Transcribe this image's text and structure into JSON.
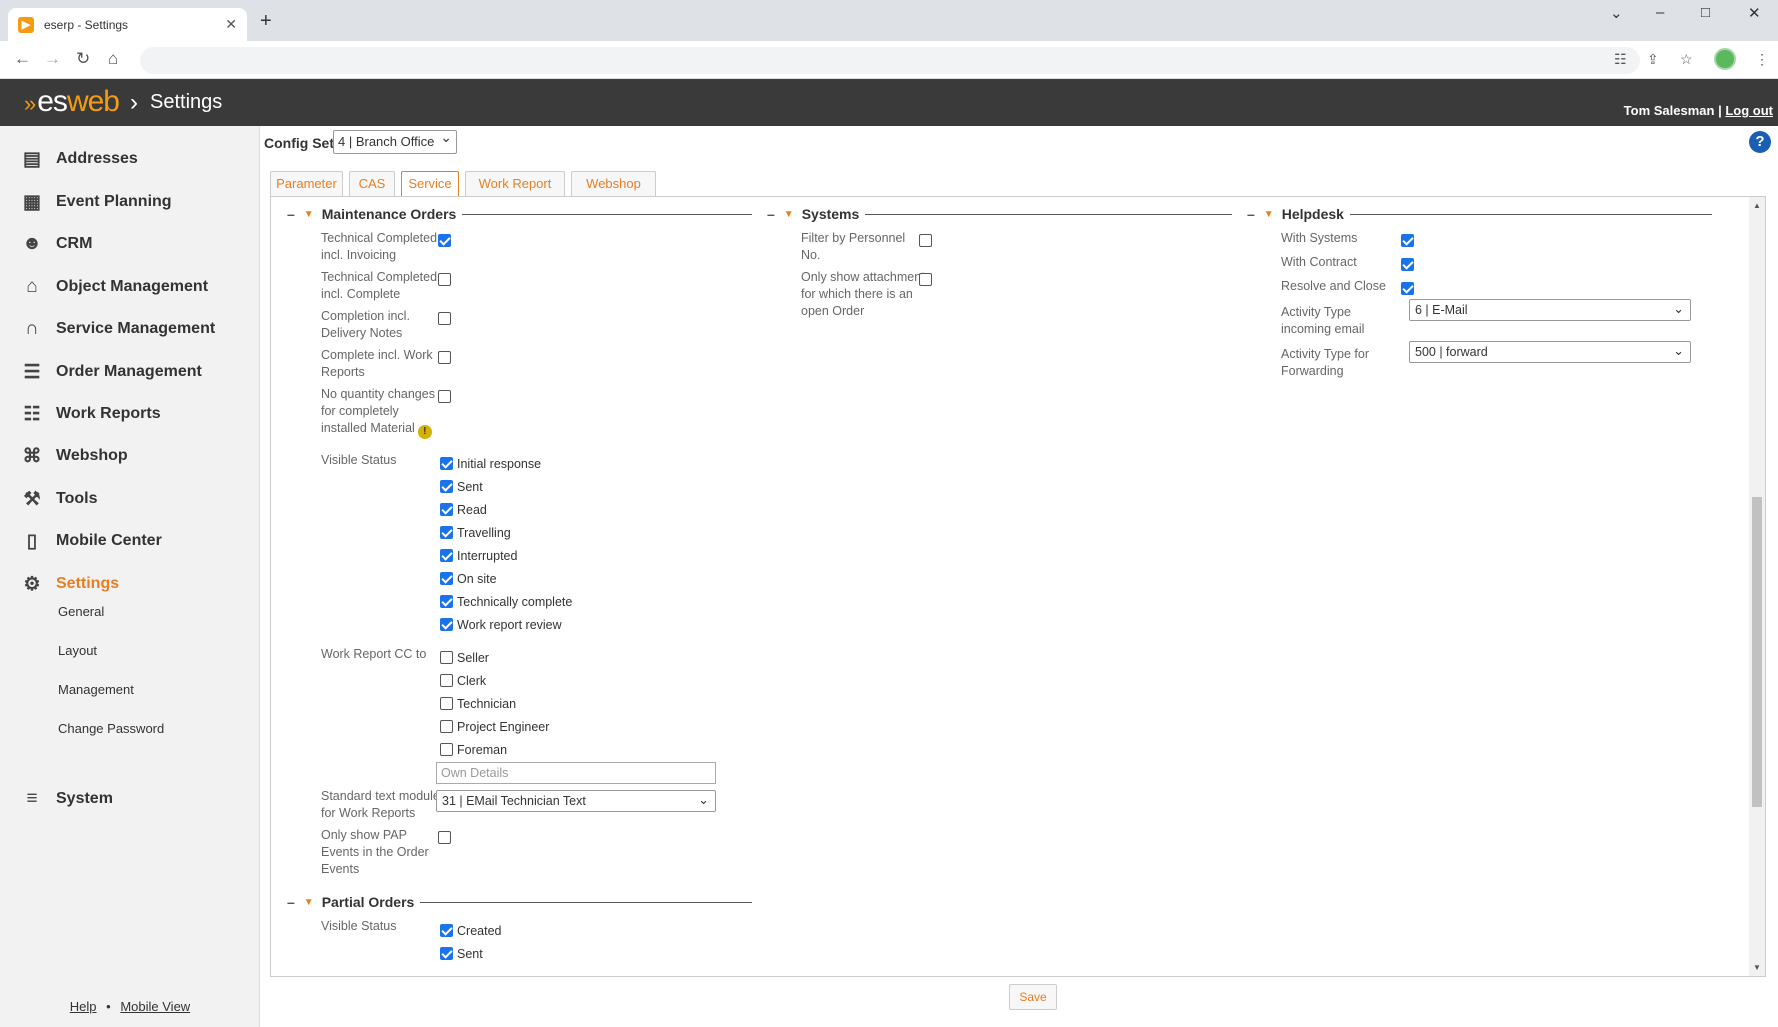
{
  "browser": {
    "tab_title": "eserp - Settings",
    "favicon": "esweb-favicon"
  },
  "header": {
    "logo_es": "es",
    "logo_web": "web",
    "breadcrumb": "Settings",
    "user": "Tom Salesman",
    "separator": " | ",
    "logout": "Log out"
  },
  "sidebar": {
    "items": [
      {
        "label": "Addresses",
        "icon": "addressbook-icon"
      },
      {
        "label": "Event Planning",
        "icon": "calendar-icon"
      },
      {
        "label": "CRM",
        "icon": "people-icon"
      },
      {
        "label": "Object Management",
        "icon": "factory-icon"
      },
      {
        "label": "Service Management",
        "icon": "headset-icon"
      },
      {
        "label": "Order Management",
        "icon": "list-icon"
      },
      {
        "label": "Work Reports",
        "icon": "clipboard-icon"
      },
      {
        "label": "Webshop",
        "icon": "cart-icon"
      },
      {
        "label": "Tools",
        "icon": "tools-icon"
      },
      {
        "label": "Mobile Center",
        "icon": "mobile-icon"
      },
      {
        "label": "Settings",
        "icon": "gears-icon"
      },
      {
        "label": "System",
        "icon": "database-icon"
      }
    ],
    "subitems": [
      "General",
      "Layout",
      "Management",
      "Change Password"
    ],
    "footer_help": "Help",
    "footer_dot": "•",
    "footer_mobile": "Mobile View"
  },
  "config": {
    "label": "Config Set",
    "value": "4 | Branch Office"
  },
  "tabs": [
    "Parameter",
    "CAS",
    "Service",
    "Work Report",
    "Webshop"
  ],
  "active_tab": "Service",
  "maintenance": {
    "title": "Maintenance Orders",
    "rows": [
      {
        "label": "Technical Completed incl. Invoicing",
        "checked": true
      },
      {
        "label": "Technical Completed incl. Complete",
        "checked": false
      },
      {
        "label": "Completion incl. Delivery Notes",
        "checked": false
      },
      {
        "label": "Complete incl. Work Reports",
        "checked": false
      },
      {
        "label": "No quantity changes for completely installed Material",
        "checked": false
      }
    ],
    "visible_status_label": "Visible Status",
    "visible_status": [
      {
        "label": "Initial response",
        "checked": true
      },
      {
        "label": "Sent",
        "checked": true
      },
      {
        "label": "Read",
        "checked": true
      },
      {
        "label": "Travelling",
        "checked": true
      },
      {
        "label": "Interrupted",
        "checked": true
      },
      {
        "label": "On site",
        "checked": true
      },
      {
        "label": "Technically complete",
        "checked": true
      },
      {
        "label": "Work report review",
        "checked": true
      }
    ],
    "cc_label": "Work Report CC to",
    "cc": [
      {
        "label": "Seller",
        "checked": false
      },
      {
        "label": "Clerk",
        "checked": false
      },
      {
        "label": "Technician",
        "checked": false
      },
      {
        "label": "Project Engineer",
        "checked": false
      },
      {
        "label": "Foreman",
        "checked": false
      }
    ],
    "own_details_placeholder": "Own Details",
    "std_text_label": "Standard text module for Work Reports",
    "std_text_value": "31 | EMail Technician Text",
    "pap_label": "Only show PAP Events in the Order Events",
    "pap_checked": false
  },
  "partial": {
    "title": "Partial Orders",
    "visible_status_label": "Visible Status",
    "visible_status": [
      {
        "label": "Created",
        "checked": true
      },
      {
        "label": "Sent",
        "checked": true
      }
    ]
  },
  "systems": {
    "title": "Systems",
    "rows": [
      {
        "label": "Filter by Personnel No.",
        "checked": false
      },
      {
        "label": "Only show attachments for which there is an open Order",
        "checked": false
      }
    ]
  },
  "helpdesk": {
    "title": "Helpdesk",
    "rows": [
      {
        "label": "With Systems",
        "checked": true
      },
      {
        "label": "With Contract",
        "checked": true
      },
      {
        "label": "Resolve and Close",
        "checked": true
      }
    ],
    "activity_email_label": "Activity Type incoming email",
    "activity_email_value": "6 | E-Mail",
    "activity_forward_label": "Activity Type for Forwarding",
    "activity_forward_value": "500 | forward"
  },
  "save_label": "Save"
}
